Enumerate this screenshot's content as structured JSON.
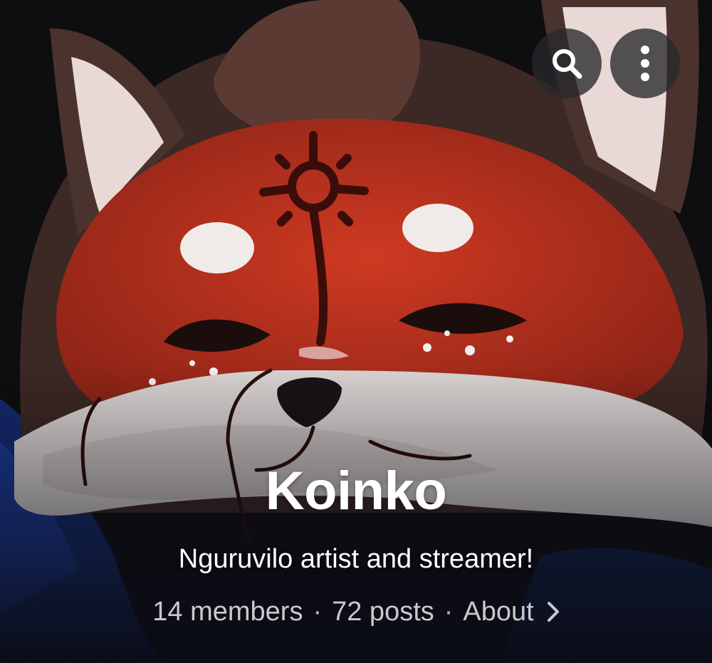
{
  "header": {
    "search_icon": "search-icon",
    "more_icon": "more-vertical-icon"
  },
  "creator": {
    "name": "Koinko",
    "tagline": "Nguruvilo artist and streamer!"
  },
  "stats": {
    "members": "14 members",
    "posts": "72 posts",
    "separator": "·",
    "about": "About"
  },
  "colors": {
    "fox_red": "#c8321c",
    "fur_brown": "#3d2a26",
    "ear_inner": "#e9d9d6",
    "background": "#0b0d14"
  }
}
